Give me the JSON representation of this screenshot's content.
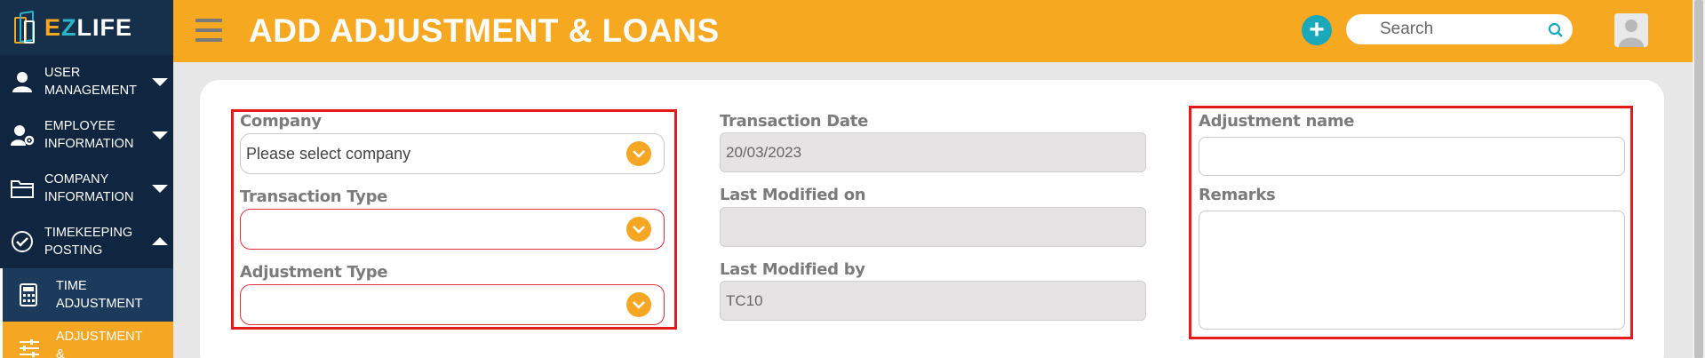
{
  "brand": {
    "e": "E",
    "z": "Z",
    "life": "LIFE"
  },
  "sidebar": {
    "items": [
      {
        "line1": "USER",
        "line2": "MANAGEMENT",
        "icon": "user-icon",
        "expanded": false
      },
      {
        "line1": "EMPLOYEE",
        "line2": "INFORMATION",
        "icon": "user-gear-icon",
        "expanded": false
      },
      {
        "line1": "COMPANY",
        "line2": "INFORMATION",
        "icon": "folder-icon",
        "expanded": false
      },
      {
        "line1": "TIMEKEEPING",
        "line2": "POSTING",
        "icon": "check-circle-icon",
        "expanded": true
      }
    ],
    "subitems": [
      {
        "line1": "TIME",
        "line2": "ADJUSTMENT",
        "icon": "calculator-icon",
        "active": false
      },
      {
        "line1": "ADJUSTMENT &",
        "line2": "",
        "icon": "sliders-icon",
        "active": true
      }
    ]
  },
  "header": {
    "title": "ADD ADJUSTMENT & LOANS",
    "add_symbol": "+",
    "search_placeholder": "Search"
  },
  "form": {
    "company": {
      "label": "Company",
      "value": "Please select company"
    },
    "transaction_type": {
      "label": "Transaction Type",
      "value": ""
    },
    "adjustment_type": {
      "label": "Adjustment Type",
      "value": ""
    },
    "transaction_date": {
      "label": "Transaction Date",
      "value": "20/03/2023"
    },
    "last_modified_on": {
      "label": "Last Modified on",
      "value": ""
    },
    "last_modified_by": {
      "label": "Last Modified by",
      "value": "TC10"
    },
    "adjustment_name": {
      "label": "Adjustment name",
      "value": ""
    },
    "remarks": {
      "label": "Remarks",
      "value": ""
    }
  },
  "colors": {
    "accent": "#f6a821",
    "sidebar": "#17304d",
    "teal": "#1aa8bb",
    "error": "#e31b1b"
  }
}
